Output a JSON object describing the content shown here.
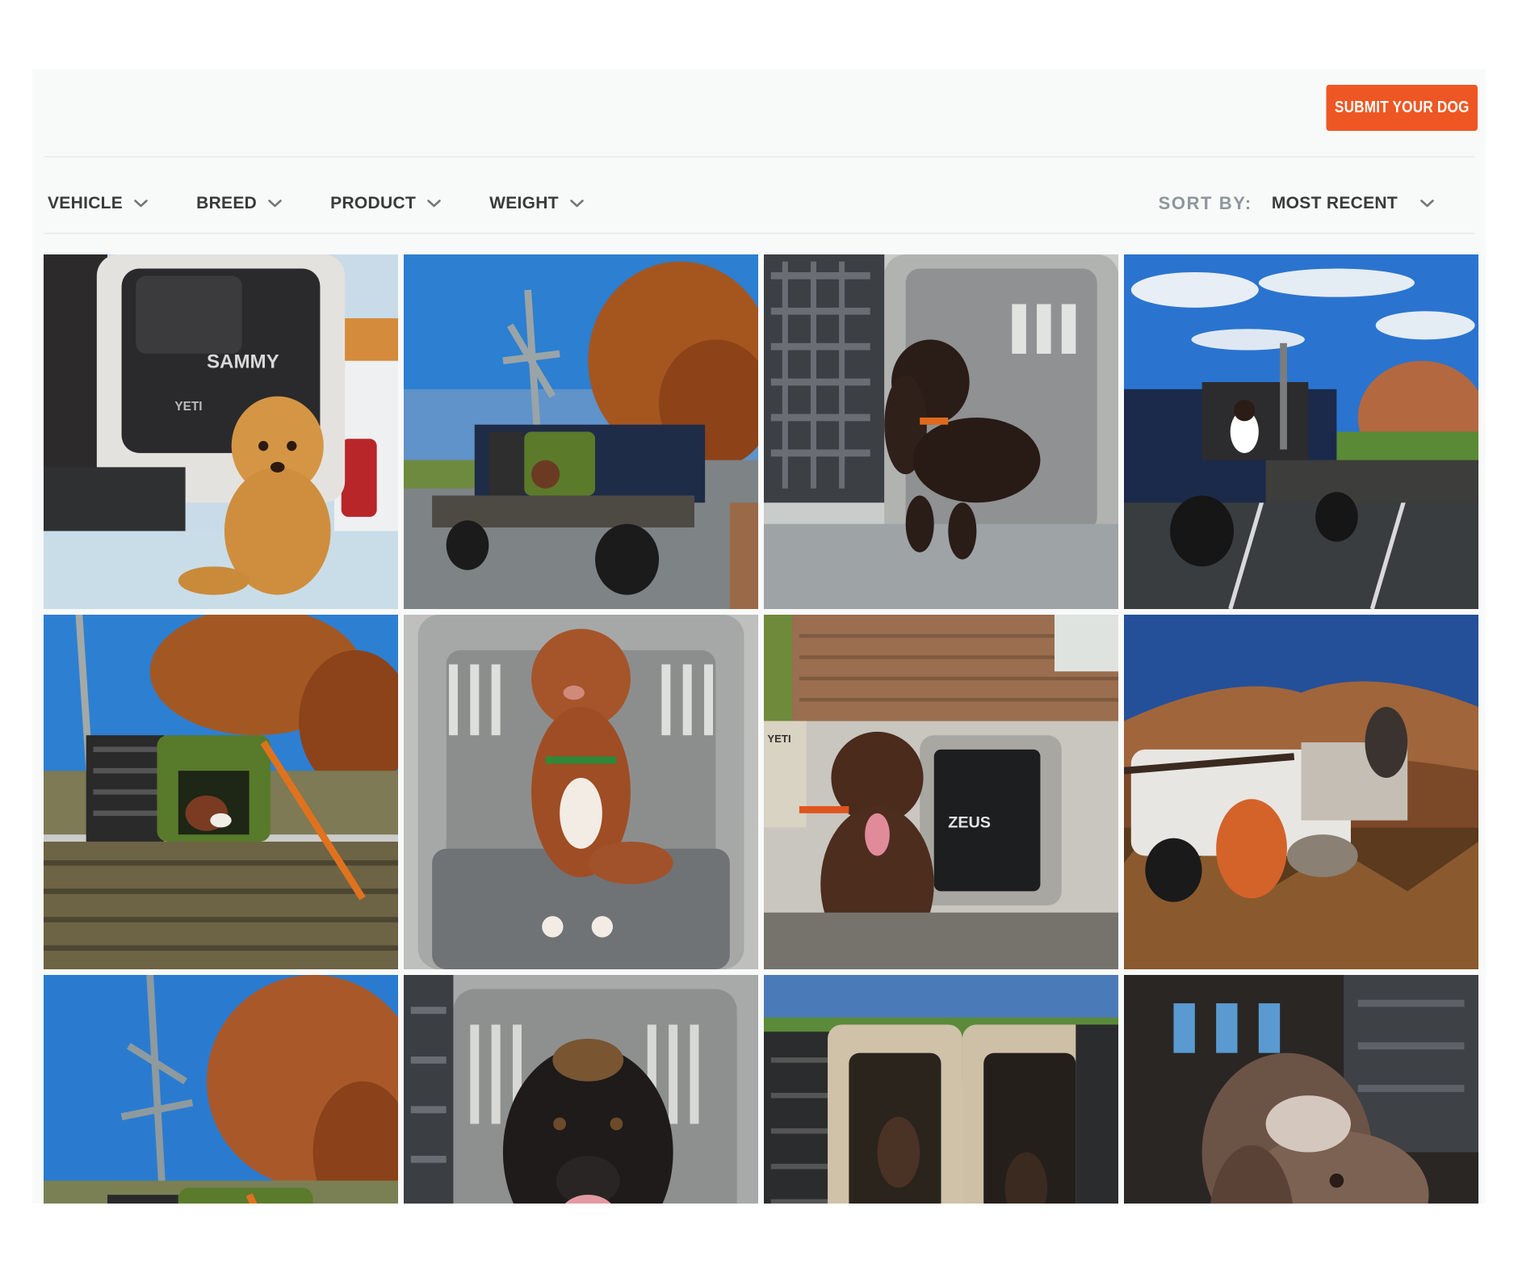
{
  "header": {
    "submit_label": "SUBMIT YOUR DOG"
  },
  "filters": [
    {
      "label": "VEHICLE"
    },
    {
      "label": "BREED"
    },
    {
      "label": "PRODUCT"
    },
    {
      "label": "WEIGHT"
    }
  ],
  "sort": {
    "label": "SORT BY:",
    "value": "MOST RECENT"
  },
  "gallery": {
    "photos": [
      {
        "subject": "golden retriever puppy on truck tailgate",
        "crate_text": "SAMMY",
        "brand_text": "YETI"
      },
      {
        "subject": "flatbed truck with green crate under autumn tree"
      },
      {
        "subject": "curly brown dog in crate"
      },
      {
        "subject": "dog on blue flatbed truck in parking lot"
      },
      {
        "subject": "dog in green crate on flatbed"
      },
      {
        "subject": "wet red dog sitting in grey crate"
      },
      {
        "subject": "chocolate lab in front of crate",
        "crate_text": "ZEUS",
        "brand_text": "YETI"
      },
      {
        "subject": "hunting dog on white truck in mountains"
      },
      {
        "subject": "dog in green crate, autumn tree"
      },
      {
        "subject": "black dog in crate"
      },
      {
        "subject": "two dogs in tan crates"
      },
      {
        "subject": "dog drinking from bowl in crate"
      }
    ]
  },
  "colors": {
    "accent": "#ee5723",
    "panel_bg": "#f8f9f9",
    "text_dark": "#3a3a3a",
    "text_muted": "#8e969b"
  }
}
